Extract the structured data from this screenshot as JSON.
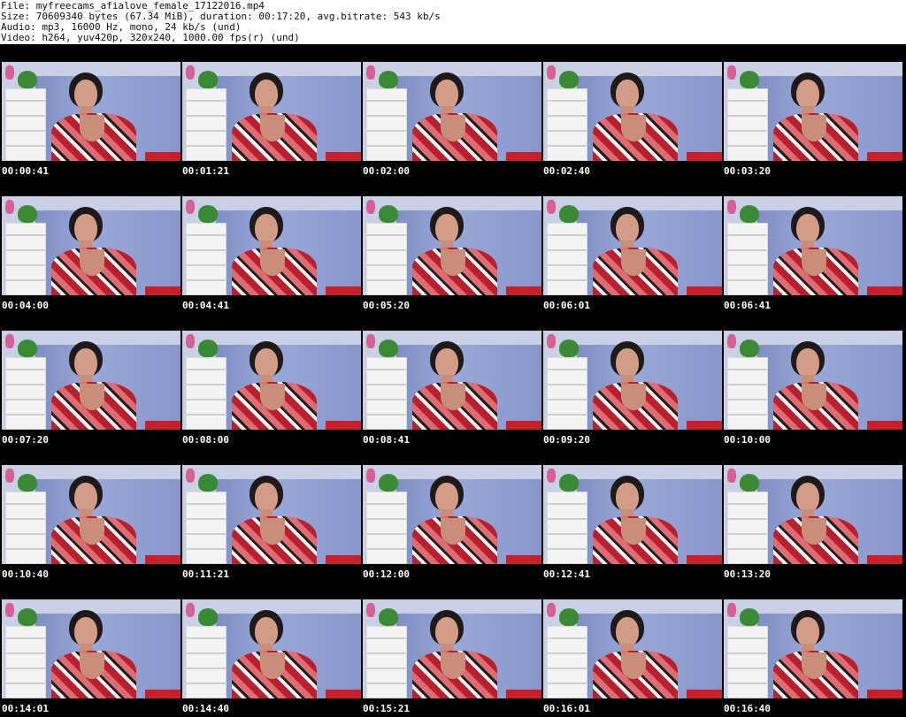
{
  "header": {
    "file_line": "File: myfreecams_afialove_female_17122016.mp4",
    "size_line": "Size: 70609340 bytes (67.34 MiB), duration: 00:17:20, avg.bitrate: 543 kb/s",
    "audio_line": "Audio: mp3, 16000 Hz, mono, 24 kb/s (und)",
    "video_line": "Video: h264, yuv420p, 320x240, 1000.00 fps(r) (und)"
  },
  "thumbnails": [
    {
      "timestamp": "00:00:41"
    },
    {
      "timestamp": "00:01:21"
    },
    {
      "timestamp": "00:02:00"
    },
    {
      "timestamp": "00:02:40"
    },
    {
      "timestamp": "00:03:20"
    },
    {
      "timestamp": "00:04:00"
    },
    {
      "timestamp": "00:04:41"
    },
    {
      "timestamp": "00:05:20"
    },
    {
      "timestamp": "00:06:01"
    },
    {
      "timestamp": "00:06:41"
    },
    {
      "timestamp": "00:07:20"
    },
    {
      "timestamp": "00:08:00"
    },
    {
      "timestamp": "00:08:41"
    },
    {
      "timestamp": "00:09:20"
    },
    {
      "timestamp": "00:10:00"
    },
    {
      "timestamp": "00:10:40"
    },
    {
      "timestamp": "00:11:21"
    },
    {
      "timestamp": "00:12:00"
    },
    {
      "timestamp": "00:12:41"
    },
    {
      "timestamp": "00:13:20"
    },
    {
      "timestamp": "00:14:01"
    },
    {
      "timestamp": "00:14:40"
    },
    {
      "timestamp": "00:15:21"
    },
    {
      "timestamp": "00:16:01"
    },
    {
      "timestamp": "00:16:40"
    }
  ],
  "colors": {
    "background": "#000000",
    "header_bg": "#ffffff",
    "header_text": "#111111",
    "timestamp_text": "#ffffff"
  }
}
